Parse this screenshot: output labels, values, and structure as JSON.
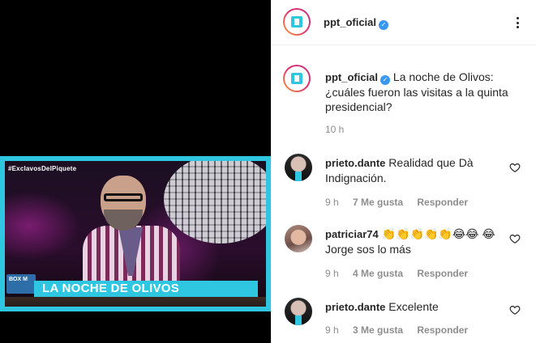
{
  "media": {
    "hashtag": "#ExclavosDelPiquete",
    "lower_third": "LA NOCHE DE OLIVOS",
    "box_logo": "BOX M"
  },
  "header": {
    "username": "ppt_oficial",
    "verified_icon": "verified-badge-icon",
    "more_icon": "more-options-icon"
  },
  "caption": {
    "username": "ppt_oficial",
    "text": "La noche de Olivos: ¿cuáles fueron las visitas a la quinta presidencial?",
    "time": "10 h"
  },
  "comments": [
    {
      "username": "prieto.dante",
      "text": "Realidad que Dà Indignación.",
      "time": "9 h",
      "likes": "7 Me gusta",
      "reply": "Responder"
    },
    {
      "username": "patriciar74",
      "text": "👏👏👏👏👏😂😂 😂 Jorge sos lo más",
      "time": "9 h",
      "likes": "4 Me gusta",
      "reply": "Responder"
    },
    {
      "username": "prieto.dante",
      "text": "Excelente",
      "time": "9 h",
      "likes": "3 Me gusta",
      "reply": "Responder"
    }
  ],
  "colors": {
    "accent_cyan": "#2ec6e0",
    "verified_blue": "#3897f0",
    "meta_gray": "#8e8e8e",
    "text": "#262626"
  }
}
